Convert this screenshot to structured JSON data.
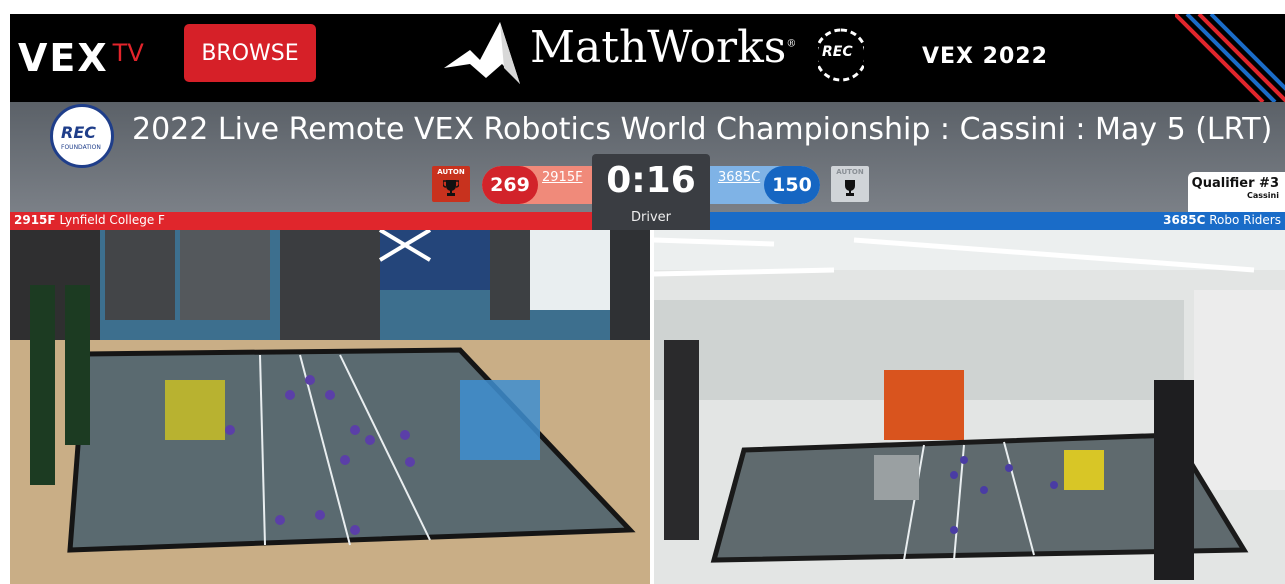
{
  "header": {
    "brand": {
      "vex": "VEX",
      "tv": "TV"
    },
    "browse_label": "BROWSE",
    "sponsor": "MathWorks",
    "sponsor_mark": "®",
    "foundation_logo": "REC",
    "foundation_sub": "FOUNDATION",
    "worlds_mark": "VEX 2022"
  },
  "event": {
    "title": "2022 Live Remote VEX Robotics World Championship : Cassini  :  May 5 (LRT)"
  },
  "scoreboard": {
    "auton_label": "AUTON",
    "red": {
      "score": "269",
      "team": "2915F"
    },
    "blue": {
      "score": "150",
      "team": "3685C"
    },
    "time": "0:16",
    "phase": "Driver",
    "match": "Qualifier #3",
    "division": "Cassini"
  },
  "alliances": {
    "red": {
      "team": "2915F",
      "name": "Lynfield College F"
    },
    "blue": {
      "team": "3685C",
      "name": "Robo Riders"
    }
  },
  "colors": {
    "red_alliance": "#e0262c",
    "blue_alliance": "#1a6cc8",
    "browse_button": "#d62028"
  },
  "icons": [
    "trophy-icon",
    "mathworks-logo-icon",
    "rec-foundation-logo-icon"
  ]
}
